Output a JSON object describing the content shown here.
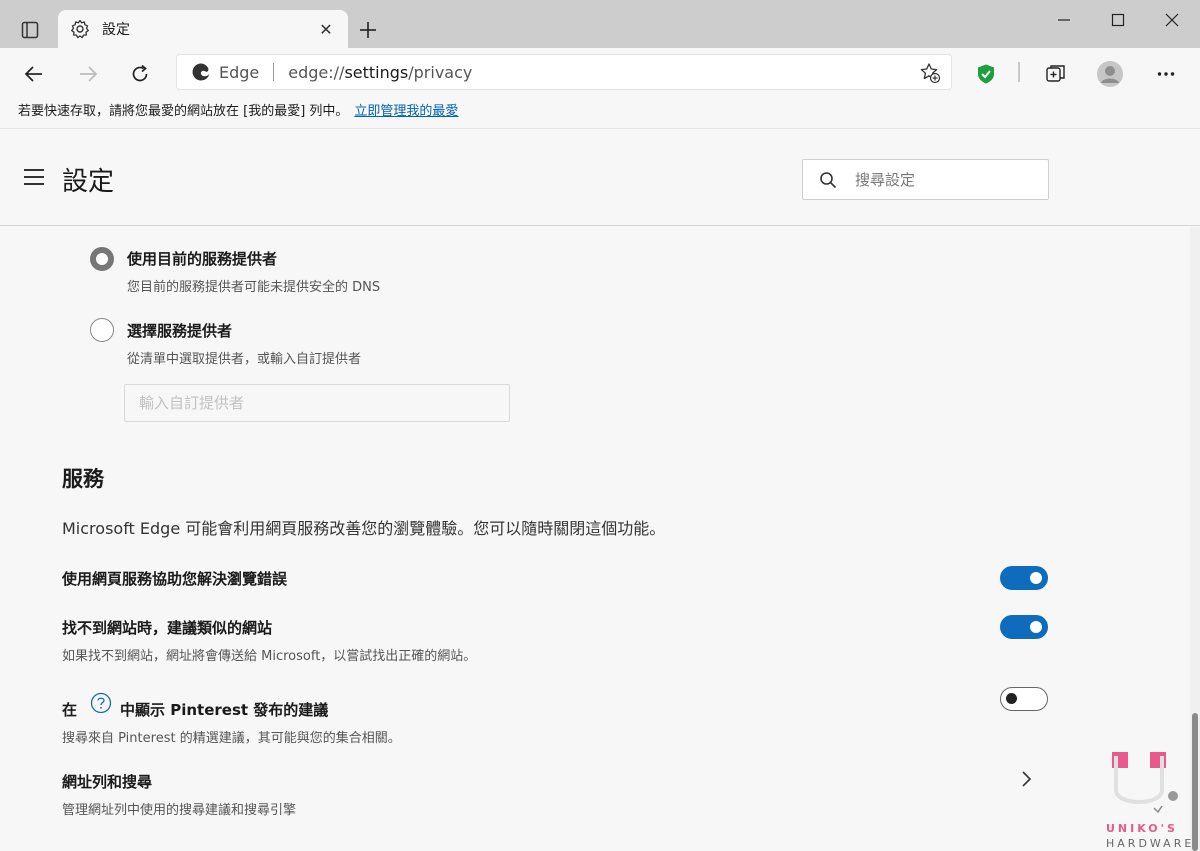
{
  "tab": {
    "title": "設定",
    "close": "✕"
  },
  "window": {
    "minimize": "—",
    "close": "✕"
  },
  "address": {
    "site": "Edge",
    "url_prefix": "edge://",
    "url_highlight": "settings",
    "url_suffix": "/privacy"
  },
  "favorites_bar": {
    "text": "若要快速存取，請將您最愛的網站放在 [我的最愛] 列中。",
    "link": "立即管理我的最愛"
  },
  "settings": {
    "title": "設定",
    "search_placeholder": "搜尋設定"
  },
  "dns": {
    "current": {
      "title": "使用目前的服務提供者",
      "desc": "您目前的服務提供者可能未提供安全的 DNS",
      "selected": true
    },
    "choose": {
      "title": "選擇服務提供者",
      "desc": "從清單中選取提供者，或輸入自訂提供者",
      "selected": false
    },
    "custom_placeholder": "輸入自訂提供者"
  },
  "services": {
    "title": "服務",
    "desc": "Microsoft Edge 可能會利用網頁服務改善您的瀏覽體驗。您可以隨時關閉這個功能。",
    "rows": [
      {
        "title": "使用網頁服務協助您解決瀏覽錯誤",
        "desc": "",
        "enabled": true
      },
      {
        "title": "找不到網站時，建議類似的網站",
        "desc": "如果找不到網站，網址將會傳送給 Microsoft，以嘗試找出正確的網站。",
        "enabled": true
      },
      {
        "title_prefix": "在",
        "title_suffix": "中顯示 Pinterest 發布的建議",
        "desc": "搜尋來自 Pinterest 的精選建議，其可能與您的集合相關。",
        "enabled": false
      },
      {
        "title": "網址列和搜尋",
        "desc": "管理網址列中使用的搜尋建議和搜尋引擎"
      }
    ]
  },
  "watermark": {
    "line1": "UNIKO'S",
    "line2": "HARDWARE"
  },
  "colors": {
    "accent": "#0f6cbd",
    "link": "#0063b1",
    "shield": "#1e9e3e",
    "watermark_pink": "#e95a8c"
  }
}
